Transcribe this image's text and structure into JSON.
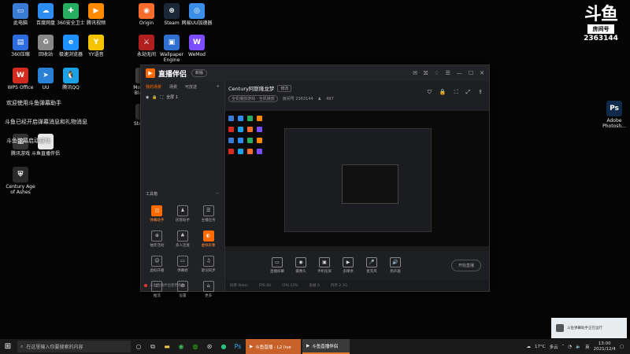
{
  "desktop_icons": [
    {
      "label": "此电脑",
      "color": "#3a7bd5",
      "glyph": "▭"
    },
    {
      "label": "百度网盘",
      "color": "#2d8cf0",
      "glyph": "☁"
    },
    {
      "label": "360安全卫士",
      "color": "#27ae60",
      "glyph": "✚"
    },
    {
      "label": "腾讯视频",
      "color": "#ff8a00",
      "glyph": "▶"
    },
    {
      "label": "360压缩",
      "color": "#2d6cdf",
      "glyph": "▤"
    },
    {
      "label": "回收站",
      "color": "#888888",
      "glyph": "♻"
    },
    {
      "label": "极速浏览器",
      "color": "#1e90ff",
      "glyph": "e"
    },
    {
      "label": "YY语音",
      "color": "#f5c400",
      "glyph": "Y"
    },
    {
      "label": "WPS Office",
      "color": "#d52b1e",
      "glyph": "W"
    },
    {
      "label": "UU",
      "color": "#2a80d5",
      "glyph": "➤"
    },
    {
      "label": "腾讯QQ",
      "color": "#1aa1e6",
      "glyph": "🐧"
    },
    {
      "label": "Origin",
      "color": "#f56c2d",
      "glyph": "◉"
    },
    {
      "label": "Steam",
      "color": "#1b2838",
      "glyph": "⊛"
    },
    {
      "label": "网易UU加速器",
      "color": "#3b8ee8",
      "glyph": "◎"
    },
    {
      "label": "永劫无间",
      "color": "#b01e1e",
      "glyph": "⚔"
    },
    {
      "label": "Wallpaper Engine",
      "color": "#2f6fd0",
      "glyph": "▣"
    },
    {
      "label": "WeMod",
      "color": "#7c4dff",
      "glyph": "W"
    },
    {
      "label": "Mount & Blade II",
      "color": "#444444",
      "glyph": "B"
    },
    {
      "label": "Stellaris",
      "color": "#333333",
      "glyph": "✦"
    },
    {
      "label": "腾讯游戏",
      "color": "#333333",
      "glyph": "▦"
    },
    {
      "label": "斗鱼直播伴侣",
      "color": "#e8e8e8",
      "glyph": "▭"
    },
    {
      "label": "Century Age of Ashes",
      "color": "#2a2a2a",
      "glyph": "⛨"
    },
    {
      "label": "Adobe Photosh...",
      "color": "#0f2a4a",
      "glyph": "Ps"
    }
  ],
  "overlay": {
    "line1": "欢迎使用斗鱼弹幕助手",
    "line2": "斗鱼已经开启弹幕消息和礼物消息",
    "line3": "斗鱼弹幕启动成功"
  },
  "room_badge": {
    "logo": "斗鱼",
    "label": "房间号",
    "number": "2363144"
  },
  "app": {
    "name": "直播伴侣",
    "version": "新版",
    "left_tabs": [
      "我的场景",
      "场景",
      "可放送"
    ],
    "scene_name": "全屏 1",
    "tools_title": "工具箱",
    "tools": [
      {
        "label": "弹幕助手",
        "glyph": "◫",
        "hot": true
      },
      {
        "label": "房管助手",
        "glyph": "♟",
        "hot": false
      },
      {
        "label": "主播任务",
        "glyph": "☰",
        "hot": false
      },
      {
        "label": "抽奖活动",
        "glyph": "⊕",
        "hot": false
      },
      {
        "label": "多人连麦",
        "glyph": "♣",
        "hot": false
      },
      {
        "label": "虚拟形象",
        "glyph": "◐",
        "hot": true
      },
      {
        "label": "虚拟开播",
        "glyph": "☺",
        "hot": false
      },
      {
        "label": "弹幕姬",
        "glyph": "▭",
        "hot": false
      },
      {
        "label": "歌词同步",
        "glyph": "♫",
        "hot": false
      },
      {
        "label": "推流",
        "glyph": "⇪",
        "hot": false
      },
      {
        "label": "设置",
        "glyph": "⚙",
        "hot": false
      },
      {
        "label": "更多",
        "glyph": "⌂",
        "hot": false
      }
    ],
    "footer_note": "斗鱼直播伴侣使用帮助",
    "room_title": "Century阿斯隆龙梦",
    "edit_label": "修改",
    "category": "全机播放游戏 · 全机播放",
    "room_id_label": "房间号 2363144",
    "viewers": "497",
    "head_icons": [
      "⛉",
      "🔒",
      "⛶",
      "⤢",
      "⇪"
    ],
    "bottom_tools": [
      {
        "label": "直播屏幕",
        "glyph": "▭"
      },
      {
        "label": "摄像头",
        "glyph": "◉"
      },
      {
        "label": "手机投屏",
        "glyph": "▣"
      },
      {
        "label": "多媒体",
        "glyph": "▶"
      },
      {
        "label": "麦克风",
        "glyph": "🎤"
      },
      {
        "label": "扬声器",
        "glyph": "🔊"
      }
    ],
    "live_button": "开始直播",
    "status_items": [
      "码率 0kb/s",
      "FPS 60",
      "CPU 12%",
      "丢帧 0",
      "内存 2.1G"
    ]
  },
  "notification": {
    "text": "斗鱼弹幕助手正在运行"
  },
  "taskbar": {
    "search_placeholder": "在这里输入你要搜索的内容",
    "apps": [
      {
        "label": "斗鱼直播 - L2 live",
        "style": "live"
      },
      {
        "label": "斗鱼直播伴侣",
        "style": "act"
      }
    ],
    "temperature": "17°C",
    "weather": "多云",
    "ime": "英",
    "time": "13:00",
    "date": "2021/12/4"
  }
}
